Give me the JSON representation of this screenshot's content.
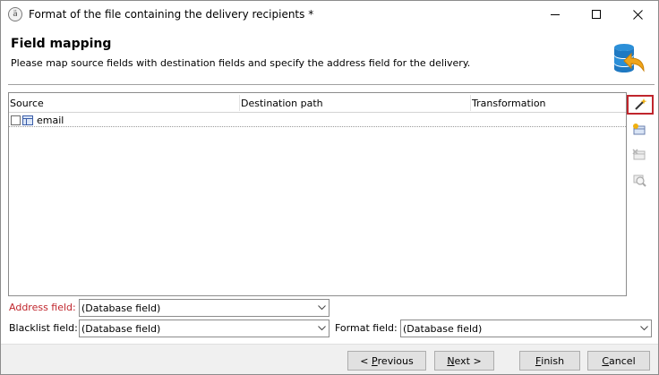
{
  "window": {
    "title": "Format of the file containing the delivery recipients *",
    "app_icon": "app-icon",
    "controls": [
      "minimize-icon",
      "maximize-icon",
      "close-icon"
    ]
  },
  "header": {
    "title": "Field mapping",
    "description": "Please map source fields with destination fields and specify the address field for the delivery.",
    "icon": "database-import-icon"
  },
  "grid": {
    "columns": [
      "Source",
      "Destination path",
      "Transformation"
    ],
    "rows": [
      {
        "source": "email",
        "destination": "",
        "transformation": "",
        "checked": false
      }
    ]
  },
  "toolbar": {
    "items": [
      "magic-wand-icon",
      "add-field-icon",
      "delete-field-icon",
      "zoom-icon"
    ],
    "highlight_color": "#c0262d"
  },
  "fields": {
    "address_label": "Address field:",
    "address_value": "(Database field)",
    "blacklist_label": "Blacklist field:",
    "blacklist_value": "(Database field)",
    "format_label": "Format field:",
    "format_value": "(Database field)",
    "required_color": "#c0262d"
  },
  "buttons": {
    "previous_mnemonic": "< P",
    "previous_rest": "revious",
    "next_mnemonic": "N",
    "next_rest": "ext >",
    "finish_mnemonic": "F",
    "finish_rest": "inish",
    "cancel_mnemonic": "C",
    "cancel_rest": "ancel"
  }
}
